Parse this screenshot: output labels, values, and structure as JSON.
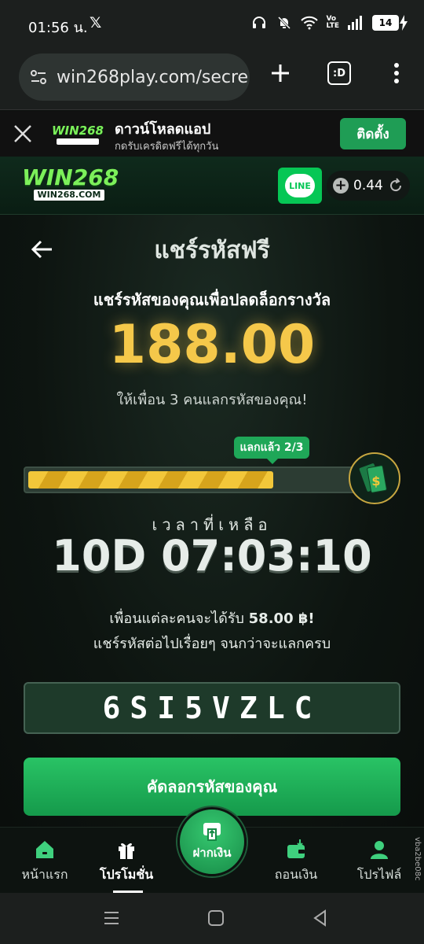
{
  "status_bar": {
    "time": "01:56 น.",
    "x_label": "𝕏",
    "volte": "Vo\nLTE",
    "battery": "14"
  },
  "browser": {
    "url": "win268play.com/secre",
    "tabs_label": ":D"
  },
  "app_banner": {
    "title": "ดาวน์โหลดแอป",
    "subtitle": "กดรับเครดิตฟรีได้ทุกวัน",
    "install_label": "ติดตั้ง",
    "logo_text": "WIN268"
  },
  "site_header": {
    "logo_text": "WIN268",
    "logo_sub": "WIN268.COM",
    "line_label": "LINE",
    "balance": "0.44"
  },
  "page": {
    "title": "แชร์รหัสฟรี",
    "subtitle": "แชร์รหัสของคุณเพื่อปลดล็อกรางวัล",
    "reward_amount": "188.00",
    "invite_text": "ให้เพื่อน 3 คนแลกรหัสของคุณ!",
    "progress_label": "แลกแล้ว 2/3",
    "progress_fraction": 0.667,
    "time_left_label": "เวลาที่เหลือ",
    "countdown": "10D 07:03:10",
    "per_friend_prefix": "เพื่อนแต่ละคนจะได้รับ",
    "per_friend_amount": "58.00 ฿!",
    "share_note": "แชร์รหัสต่อไปเรื่อยๆ จนกว่าจะแลกครบ",
    "code": "6SI5VZLC",
    "copy_button": "คัดลอกรหัสของคุณ"
  },
  "bottom_nav": {
    "home": "หน้าแรก",
    "promotions": "โปรโมชั่น",
    "deposit": "ฝากเงิน",
    "withdraw": "ถอนเงิน",
    "profile": "โปรไฟล์",
    "side_id": "vba2be08c"
  },
  "colors": {
    "accent_green": "#1fa758",
    "gold": "#f5c84a"
  }
}
